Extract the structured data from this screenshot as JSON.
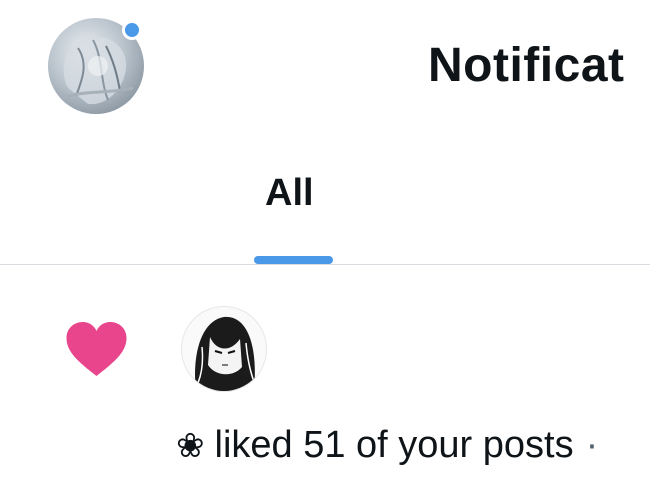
{
  "header": {
    "title": "Notificat",
    "avatar_icon": "user-avatar",
    "status_color": "#4a99e9"
  },
  "tabs": [
    {
      "label": "All",
      "active": true
    }
  ],
  "accent_color": "#4a99e9",
  "notification": {
    "icon": "heart-icon",
    "icon_color": "#e8458d",
    "flower_glyph": "❀",
    "text": "liked 51 of your posts",
    "separator": "·"
  }
}
